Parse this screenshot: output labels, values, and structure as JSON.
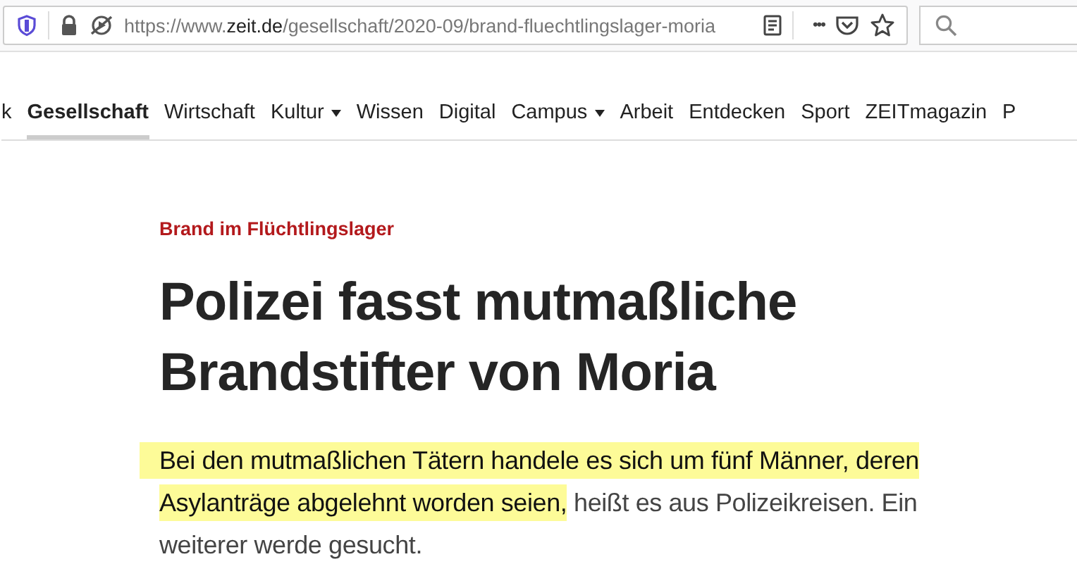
{
  "browser": {
    "url": {
      "scheme": "https://www.",
      "domain": "zeit.de",
      "path": "/gesellschaft/2020-09/brand-fluechtlingslager-moria"
    },
    "more": "•••"
  },
  "nav": [
    {
      "label": "k",
      "selected": false,
      "dropdown": false
    },
    {
      "label": "Gesellschaft",
      "selected": true,
      "dropdown": false
    },
    {
      "label": "Wirtschaft",
      "selected": false,
      "dropdown": false
    },
    {
      "label": "Kultur",
      "selected": false,
      "dropdown": true
    },
    {
      "label": "Wissen",
      "selected": false,
      "dropdown": false
    },
    {
      "label": "Digital",
      "selected": false,
      "dropdown": false
    },
    {
      "label": "Campus",
      "selected": false,
      "dropdown": true
    },
    {
      "label": "Arbeit",
      "selected": false,
      "dropdown": false
    },
    {
      "label": "Entdecken",
      "selected": false,
      "dropdown": false
    },
    {
      "label": "Sport",
      "selected": false,
      "dropdown": false
    },
    {
      "label": "ZEITmagazin",
      "selected": false,
      "dropdown": false
    },
    {
      "label": "P",
      "selected": false,
      "dropdown": false
    }
  ],
  "article": {
    "kicker": "Brand im Flüchtlingslager",
    "headline": [
      "Polizei fasst mutmaßliche",
      "Brandstifter von Moria"
    ],
    "lead": {
      "highlight": "Bei den mutmaßlichen Tätern handele es sich um fünf Männer, deren Asylanträge abgelehnt worden seien,",
      "text": " heißt es aus Polizeikreisen. Ein weiterer werde gesucht."
    }
  }
}
